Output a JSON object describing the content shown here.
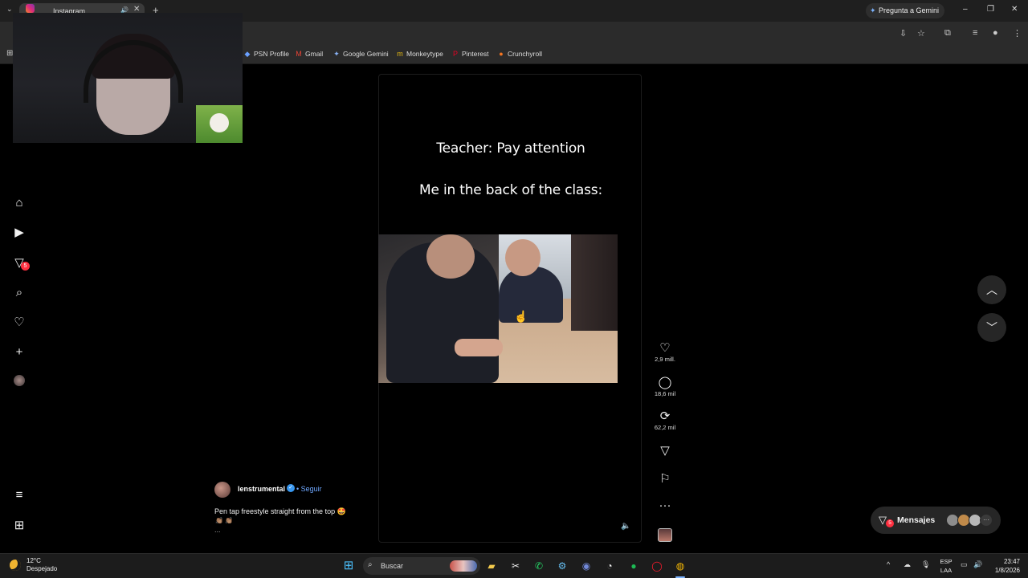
{
  "browser": {
    "tab_title": "Instagram",
    "gemini_button": "Pregunta a Gemini",
    "bookmarks": [
      "PSN Profile",
      "Gmail",
      "Google Gemini",
      "Monkeytype",
      "Pinterest",
      "Crunchyroll"
    ]
  },
  "reel": {
    "text_line1": "Teacher: Pay attention",
    "text_line2": "Me in the back of the class:",
    "likes": "2,9 mill.",
    "comments": "18,6 mil",
    "reposts": "62,2 mil",
    "author": "lenstrumental",
    "follow_label": "Seguir",
    "caption": "Pen tap freestyle straight from the top 🤩",
    "caption_line2": "👏🏽 👏🏽",
    "caption_more": "..."
  },
  "sidebar": {
    "notification_count": "5",
    "icons": [
      "home-icon",
      "reels-icon",
      "direct-icon",
      "search-icon",
      "heart-icon",
      "plus-icon",
      "profile-avatar",
      "menu-icon",
      "apps-icon"
    ]
  },
  "messages": {
    "label": "Mensajes",
    "count": "5"
  },
  "taskbar": {
    "temperature": "12°C",
    "weather": "Despejado",
    "search_placeholder": "Buscar",
    "lang_line1": "ESP",
    "lang_line2": "LAA",
    "time": "23:47",
    "date": "1/8/2026"
  },
  "colors": {
    "accent_blue": "#3897f0",
    "follow_link": "#6fa8ff",
    "notification_red": "#ff3040",
    "background": "#000000"
  }
}
